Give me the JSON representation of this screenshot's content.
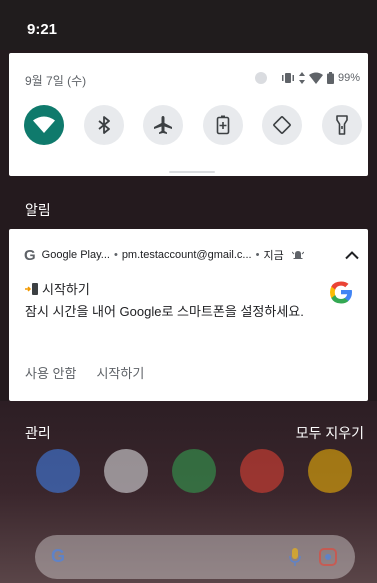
{
  "status_bar": {
    "time": "9:21"
  },
  "quick_settings": {
    "date": "9월 7일 (수)",
    "battery": "99%",
    "tiles": [
      {
        "name": "wifi",
        "state": "on"
      },
      {
        "name": "bluetooth",
        "state": "off"
      },
      {
        "name": "airplane-mode",
        "state": "off"
      },
      {
        "name": "battery-saver",
        "state": "off"
      },
      {
        "name": "auto-rotate",
        "state": "off"
      },
      {
        "name": "flashlight",
        "state": "off"
      }
    ]
  },
  "notifications_header": "알림",
  "notification": {
    "app": "Google Play...",
    "account": "pm.testaccount@gmail.c...",
    "time": "지금",
    "title": "시작하기",
    "body": "잠시 시간을 내어 Google로 스마트폰을 설정하세요.",
    "actions": [
      "사용 안함",
      "시작하기"
    ]
  },
  "footer": {
    "manage": "관리",
    "clear_all": "모두 지우기"
  },
  "colors": {
    "accent": "#0f7a6c",
    "google_blue": "#4285F4",
    "google_red": "#EA4335",
    "google_yellow": "#FBBC05",
    "google_green": "#34A853"
  }
}
